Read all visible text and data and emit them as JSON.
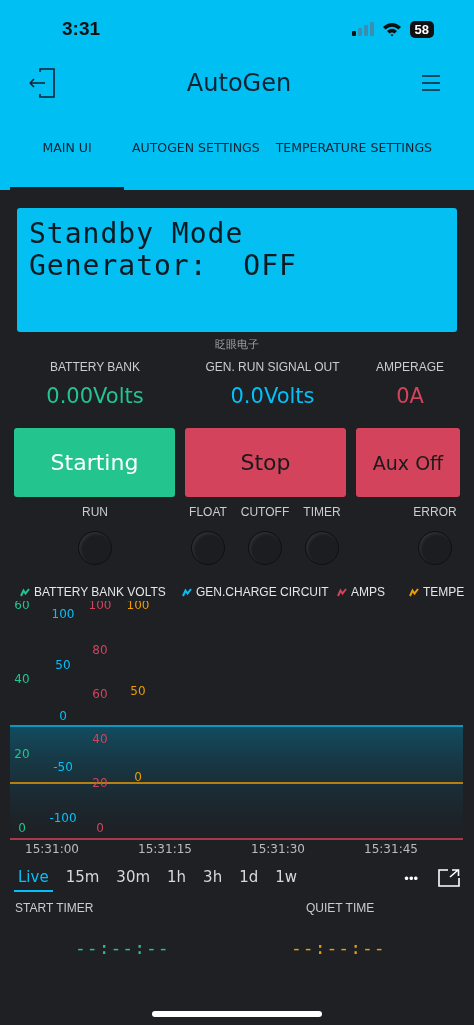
{
  "status_bar": {
    "time": "3:31",
    "battery": "58"
  },
  "header": {
    "title": "AutoGen"
  },
  "tabs": [
    {
      "label": "MAIN UI",
      "selected": true
    },
    {
      "label": "AUTOGEN SETTINGS",
      "selected": false
    },
    {
      "label": "TEMPERATURE SETTINGS",
      "selected": false
    }
  ],
  "lcd": {
    "lines": [
      "Standby Mode",
      "Generator:  OFF"
    ],
    "caption": "眨眼电子"
  },
  "displays": [
    {
      "label": "BATTERY BANK",
      "value": "0.00Volts",
      "color": "#23c48e"
    },
    {
      "label": "GEN. RUN SIGNAL OUT",
      "value": "0.0Volts",
      "color": "#04c0f8"
    },
    {
      "label": "AMPERAGE",
      "value": "0A",
      "color": "#d3435c"
    }
  ],
  "buttons": [
    {
      "label": "Starting",
      "color": "#23c48e",
      "on": true
    },
    {
      "label": "Stop",
      "color": "#d3435c",
      "on": false
    },
    {
      "label": "Aux Off",
      "color": "#d3435c",
      "on": false
    }
  ],
  "leds": [
    {
      "label": "RUN",
      "on": false
    },
    {
      "label": "FLOAT",
      "on": false
    },
    {
      "label": "CUTOFF",
      "on": false
    },
    {
      "label": "TIMER",
      "on": false
    },
    {
      "label": "ERROR",
      "on": false
    }
  ],
  "chart": {
    "legend": [
      {
        "name": "BATTERY BANK VOLTS",
        "color": "#23c48e"
      },
      {
        "name": "GEN.CHARGE CIRCUIT",
        "color": "#04c0f8"
      },
      {
        "name": "AMPS",
        "color": "#d3435c"
      },
      {
        "name": "TEMPE",
        "color": "#ed9d00"
      }
    ],
    "axes": [
      {
        "color": "#23c48e",
        "ticks": [
          "60",
          "40",
          "20",
          "0"
        ]
      },
      {
        "color": "#04c0f8",
        "ticks": [
          "100",
          "50",
          "0",
          "-50",
          "-100"
        ]
      },
      {
        "color": "#d3435c",
        "ticks": [
          "100",
          "80",
          "60",
          "40",
          "20",
          "0"
        ]
      },
      {
        "color": "#ed9d00",
        "ticks": [
          "100",
          "50",
          "0"
        ]
      }
    ],
    "x_labels": [
      "15:31:00",
      "15:31:15",
      "15:31:30",
      "15:31:45"
    ]
  },
  "ranges": [
    {
      "label": "Live",
      "selected": true
    },
    {
      "label": "15m",
      "selected": false
    },
    {
      "label": "30m",
      "selected": false
    },
    {
      "label": "1h",
      "selected": false
    },
    {
      "label": "3h",
      "selected": false
    },
    {
      "label": "1d",
      "selected": false
    },
    {
      "label": "1w",
      "selected": false
    }
  ],
  "more": "•••",
  "timers": [
    {
      "label": "START TIMER",
      "value": "--:--:--",
      "color": "#23c48e"
    },
    {
      "label": "QUIET TIME",
      "value": "--:--:--",
      "color": "#ed9d00"
    }
  ]
}
